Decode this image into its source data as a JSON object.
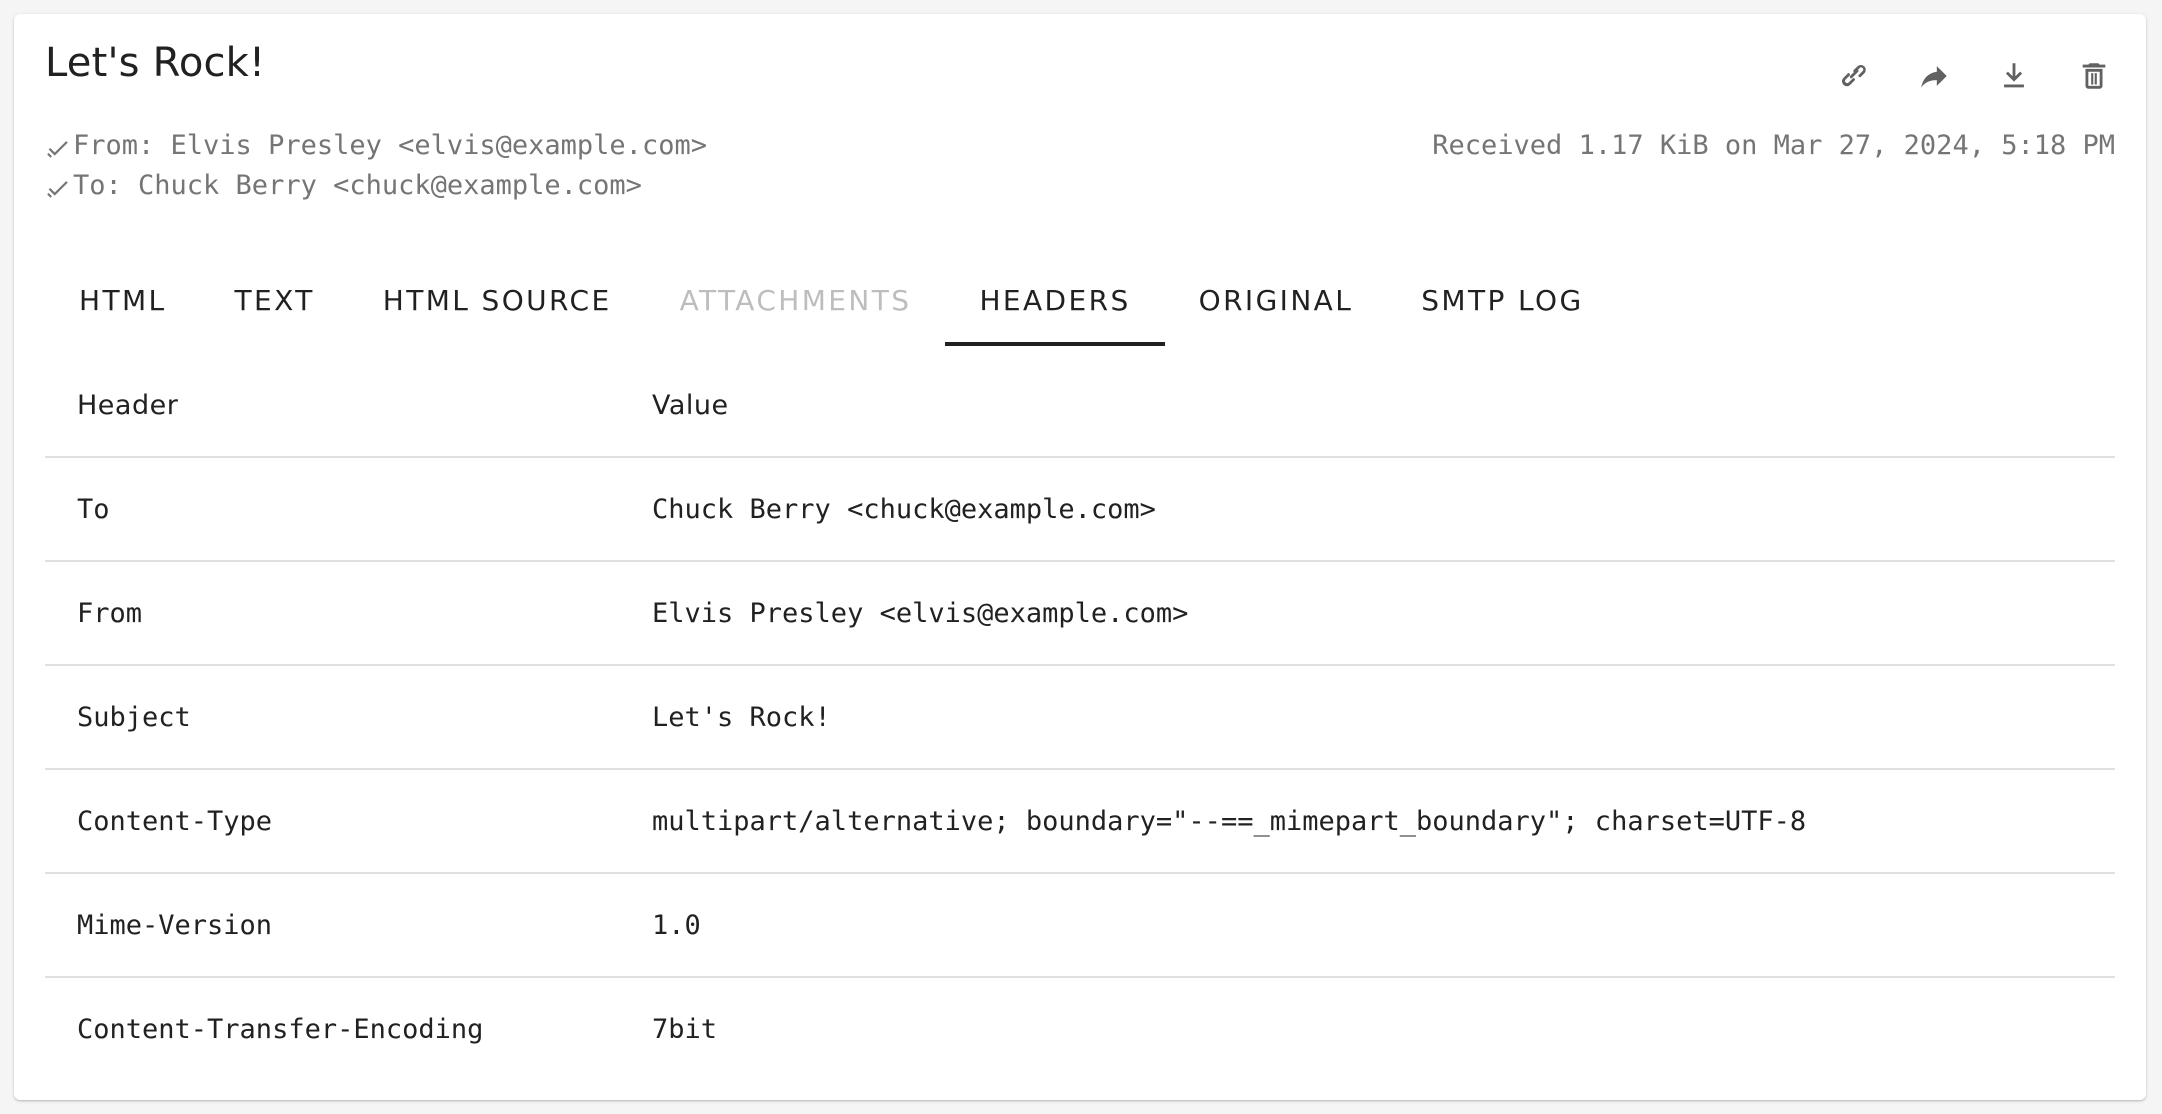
{
  "message": {
    "subject": "Let's Rock!",
    "from_label": "From: Elvis Presley <elvis@example.com>",
    "to_label": "To: Chuck Berry <chuck@example.com>",
    "received": "Received 1.17 KiB on Mar 27, 2024, 5:18 PM"
  },
  "actions": [
    {
      "icon": "link-icon"
    },
    {
      "icon": "forward-icon"
    },
    {
      "icon": "download-icon"
    },
    {
      "icon": "delete-icon"
    }
  ],
  "tabs": [
    {
      "label": "HTML",
      "active": false,
      "disabled": false
    },
    {
      "label": "TEXT",
      "active": false,
      "disabled": false
    },
    {
      "label": "HTML SOURCE",
      "active": false,
      "disabled": false
    },
    {
      "label": "ATTACHMENTS",
      "active": false,
      "disabled": true
    },
    {
      "label": "HEADERS",
      "active": true,
      "disabled": false
    },
    {
      "label": "ORIGINAL",
      "active": false,
      "disabled": false
    },
    {
      "label": "SMTP LOG",
      "active": false,
      "disabled": false
    }
  ],
  "headers_table": {
    "columns": [
      "Header",
      "Value"
    ],
    "rows": [
      {
        "header": "To",
        "value": "Chuck Berry <chuck@example.com>"
      },
      {
        "header": "From",
        "value": "Elvis Presley <elvis@example.com>"
      },
      {
        "header": "Subject",
        "value": "Let's Rock!"
      },
      {
        "header": "Content-Type",
        "value": "multipart/alternative; boundary=\"--==_mimepart_boundary\"; charset=UTF-8"
      },
      {
        "header": "Mime-Version",
        "value": "1.0"
      },
      {
        "header": "Content-Transfer-Encoding",
        "value": "7bit"
      }
    ]
  },
  "colors": {
    "text": "#212121",
    "muted": "#757575",
    "disabled": "#bdbdbd",
    "divider": "#e0e0e0",
    "icon": "#616161"
  }
}
